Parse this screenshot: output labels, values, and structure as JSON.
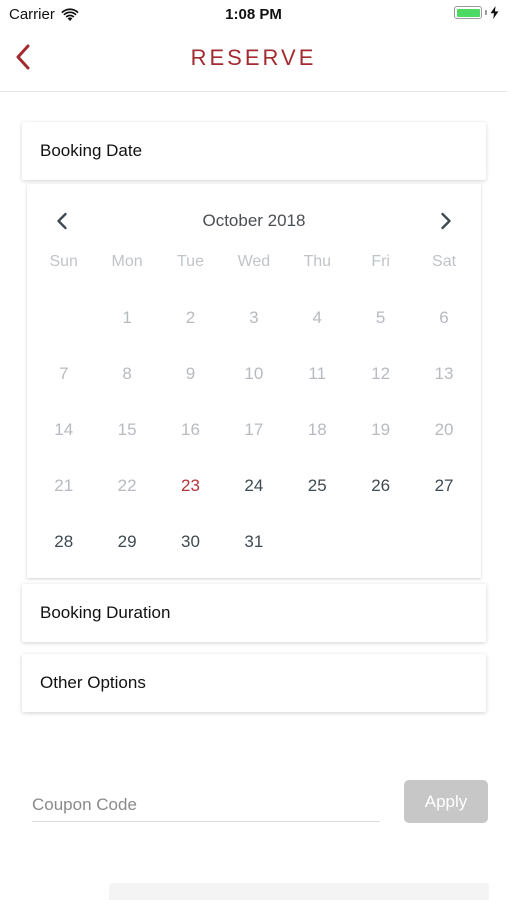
{
  "status_bar": {
    "carrier": "Carrier",
    "time": "1:08 PM",
    "battery_level": 1.0,
    "battery_color": "#4cd964"
  },
  "nav": {
    "title": "RESERVE",
    "back_icon": "chevron-left-icon",
    "accent_color": "#a32a30"
  },
  "sections": {
    "booking_date": "Booking Date",
    "booking_duration": "Booking Duration",
    "other_options": "Other Options"
  },
  "calendar": {
    "month_label": "October 2018",
    "prev_icon": "chevron-left-icon",
    "next_icon": "chevron-right-icon",
    "weekdays": [
      "Sun",
      "Mon",
      "Tue",
      "Wed",
      "Thu",
      "Fri",
      "Sat"
    ],
    "weeks": [
      [
        null,
        1,
        2,
        3,
        4,
        5,
        6
      ],
      [
        7,
        8,
        9,
        10,
        11,
        12,
        13
      ],
      [
        14,
        15,
        16,
        17,
        18,
        19,
        20
      ],
      [
        21,
        22,
        23,
        24,
        25,
        26,
        27
      ],
      [
        28,
        29,
        30,
        31,
        null,
        null,
        null
      ]
    ],
    "today": 23,
    "first_selectable_day": 23,
    "today_color": "#b3343a"
  },
  "coupon": {
    "placeholder": "Coupon Code",
    "value": "",
    "apply_label": "Apply"
  }
}
